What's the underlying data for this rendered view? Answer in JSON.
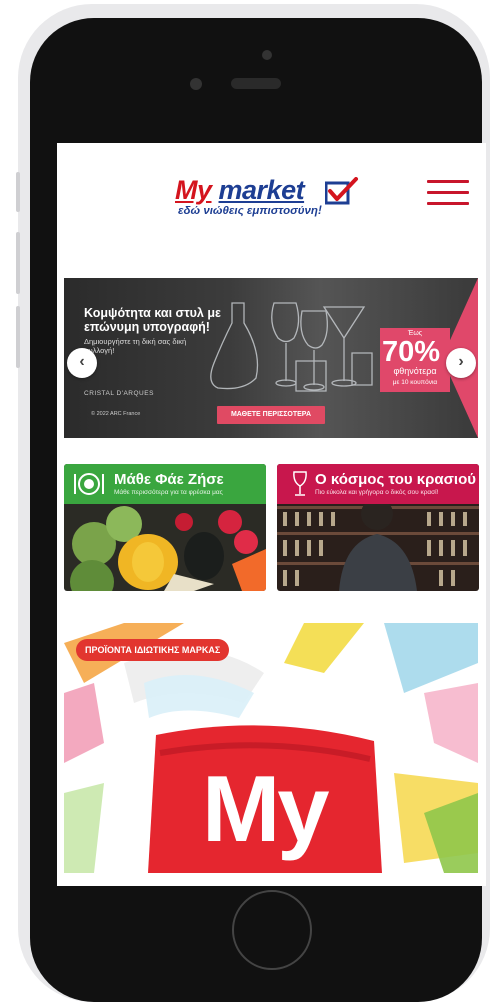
{
  "app": {
    "logo": {
      "brand_my": "My",
      "brand_market": "market",
      "tagline": "εδώ νιώθεις εμπιστοσύνη!"
    },
    "menu_icon": "hamburger-menu-icon"
  },
  "hero": {
    "title": "Κομψότητα και στυλ με επώνυμη υπογραφή!",
    "subtitle": "Δημιουργήστε τη δική σας δική συλλογή!",
    "brand": "CRISTAL D'ARQUES",
    "copyright": "© 2022 ARC France",
    "cta_label": "ΜΑΘΕΤΕ ΠΕΡΙΣΣΟΤΕΡΑ",
    "promo": {
      "upto": "Έως",
      "percent": "70%",
      "word": "φθηνότερα",
      "coupons": "με 10 κουπόνια"
    },
    "prev_icon": "chevron-left-icon",
    "next_icon": "chevron-right-icon"
  },
  "tiles": [
    {
      "title": "Μάθε Φάε Ζήσε",
      "subtitle": "Μάθε περισσότερα για τα φρέσκα μας",
      "color": "#3aa63f",
      "icon": "plate-icon"
    },
    {
      "title": "Ο κόσμος του κρασιού",
      "subtitle": "Πιο εύκολα και γρήγορα ο δικός σου κρασί!",
      "color": "#c8174d",
      "icon": "wine-glass-icon"
    }
  ],
  "private_label": {
    "pill": "ΠΡΟΪΟΝΤΑ ΙΔΙΩΤΙΚΗΣ ΜΑΡΚΑΣ",
    "big_text": "My"
  },
  "colors": {
    "brand_red": "#d4141e",
    "brand_blue": "#1d3e93",
    "promo_pink": "#e0486a"
  }
}
